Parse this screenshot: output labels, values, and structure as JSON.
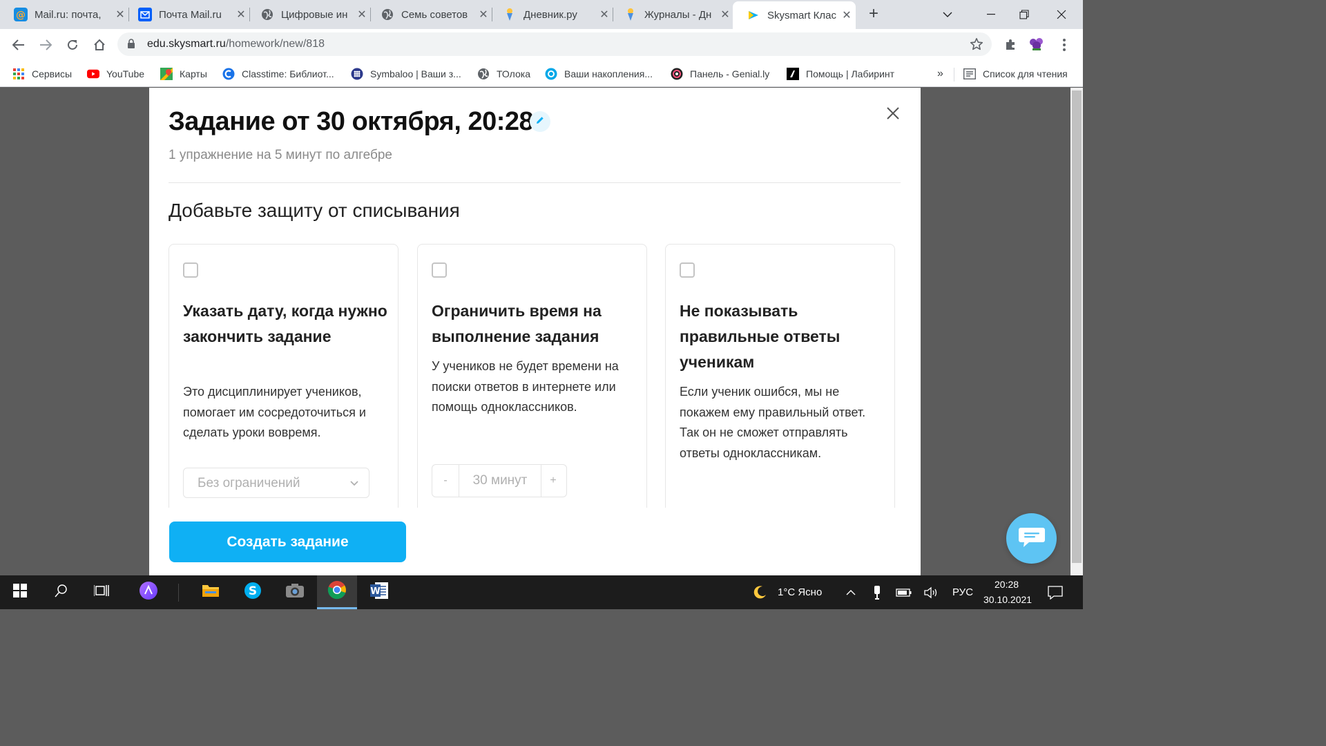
{
  "browser": {
    "tabs": [
      {
        "title": "Mail.ru: почта,",
        "icon": "mailru-icon"
      },
      {
        "title": "Почта Mail.ru",
        "icon": "mail-envelope-icon"
      },
      {
        "title": "Цифровые ин",
        "icon": "globe-icon"
      },
      {
        "title": "Семь советов",
        "icon": "globe-icon"
      },
      {
        "title": "Дневник.ру",
        "icon": "dnevnik-icon"
      },
      {
        "title": "Журналы - Дн",
        "icon": "dnevnik-icon"
      },
      {
        "title": "Skysmart Клас",
        "icon": "skysmart-icon",
        "active": true
      }
    ],
    "url_host": "edu.skysmart.ru",
    "url_path": "/homework/new/818",
    "bookmarks": [
      {
        "label": "Сервисы",
        "icon": "apps-grid-icon"
      },
      {
        "label": "YouTube",
        "icon": "youtube-icon"
      },
      {
        "label": "Карты",
        "icon": "maps-icon"
      },
      {
        "label": "Classtime: Библиот...",
        "icon": "classtime-icon"
      },
      {
        "label": "Symbaloo | Ваши з...",
        "icon": "symbaloo-icon"
      },
      {
        "label": "ТОлока",
        "icon": "globe-icon"
      },
      {
        "label": "Ваши накопления...",
        "icon": "savings-icon"
      },
      {
        "label": "Панель - Genial.ly",
        "icon": "genially-icon"
      },
      {
        "label": "Помощь | Лабиринт",
        "icon": "labirint-icon"
      }
    ],
    "bookmarks_overflow": "»",
    "reading_list": "Список для чтения"
  },
  "modal": {
    "title": "Задание от 30 октября, 20:28",
    "subtitle": "1 упражнение на 5 минут по алгебре",
    "section_title": "Добавьте защиту от списывания",
    "cards": [
      {
        "title": "Указать дату, когда нужно закончить задание",
        "description": "Это дисциплинирует учеников, помогает им сосредоточиться и сделать уроки вовремя.",
        "control_value": "Без ограничений",
        "checked": false
      },
      {
        "title": "Ограничить время на выполнение задания",
        "description": "У учеников не будет времени на поиски ответов в интернете или помощь одноклассников.",
        "stepper_minus": "-",
        "stepper_value": "30 минут",
        "stepper_plus": "+",
        "checked": false
      },
      {
        "title": "Не показывать правильные ответы ученикам",
        "description": "Если ученик ошибся, мы не покажем ему правильный ответ. Так он не сможет отправлять ответы одноклассникам.",
        "checked": false
      }
    ],
    "create_button": "Создать задание"
  },
  "taskbar": {
    "weather": "1°C  Ясно",
    "language": "РУС",
    "time": "20:28",
    "date": "30.10.2021"
  },
  "colors": {
    "accent": "#0fb0f4",
    "chat_button": "#5ec4f3",
    "overlay": "#5c5c5c"
  }
}
